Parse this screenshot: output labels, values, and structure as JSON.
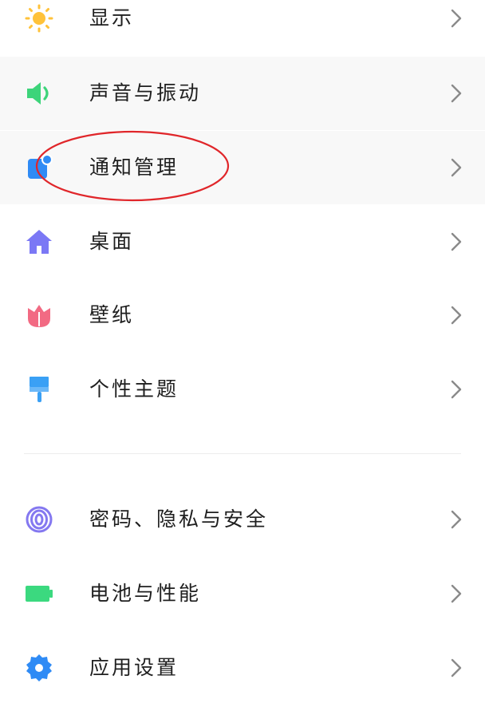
{
  "settings": {
    "items": [
      {
        "label": "显示",
        "icon": "sun-icon",
        "color": "#FFC23A"
      },
      {
        "label": "声音与振动",
        "icon": "speaker-icon",
        "color": "#3DD47A"
      },
      {
        "label": "通知管理",
        "icon": "notification-icon",
        "color": "#2F8BF5"
      },
      {
        "label": "桌面",
        "icon": "home-icon",
        "color": "#7B78F5"
      },
      {
        "label": "壁纸",
        "icon": "tulip-icon",
        "color": "#F26A83"
      },
      {
        "label": "个性主题",
        "icon": "paint-roller-icon",
        "color": "#3AA0F5"
      },
      {
        "label": "密码、隐私与安全",
        "icon": "fingerprint-icon",
        "color": "#8478F0"
      },
      {
        "label": "电池与性能",
        "icon": "battery-icon",
        "color": "#3BD97F"
      },
      {
        "label": "应用设置",
        "icon": "gear-icon",
        "color": "#2F8BF5"
      }
    ]
  },
  "annotation": {
    "shape": "ellipse",
    "color": "#E0262A",
    "target": "通知管理"
  }
}
